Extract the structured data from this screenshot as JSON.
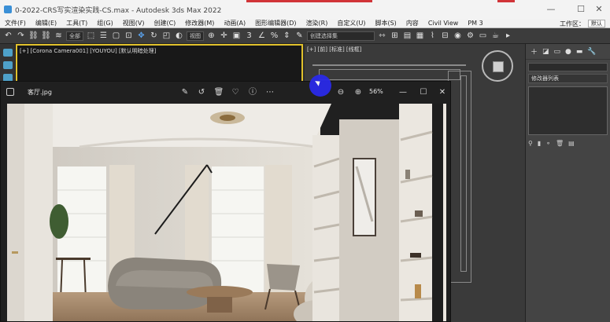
{
  "titlebar": {
    "title": "0-2022-CRS写实渲染实践-CS.max - Autodesk 3ds Max 2022",
    "minimize": "—",
    "maximize": "☐",
    "close": "✕"
  },
  "menu": {
    "items": [
      "文件(F)",
      "编辑(E)",
      "工具(T)",
      "组(G)",
      "视图(V)",
      "创建(C)",
      "修改器(M)",
      "动画(A)",
      "图形编辑器(D)",
      "渲染(R)",
      "自定义(U)",
      "脚本(S)",
      "内容",
      "Civil View",
      "PM 3"
    ],
    "workspace_label": "工作区：",
    "workspace_value": "默认"
  },
  "toolbar": {
    "filter_select": "全部",
    "coord_select": "视图",
    "selection_set": "创建选择集"
  },
  "viewport_camera": {
    "label": "[+] [Corona Camera001] [YOUYOU] [默认明暗处理]"
  },
  "viewport_left": {
    "label": "[+] [前] [标准] [线框]"
  },
  "command_panel": {
    "modifier_list": "修改器列表"
  },
  "photo_viewer": {
    "filename": "客厅.jpg",
    "zoom": "56%"
  },
  "colors": {
    "accent_yellow": "#e1c12c",
    "cursor_blue": "#2a2ae8",
    "title_red": "#d13438"
  }
}
